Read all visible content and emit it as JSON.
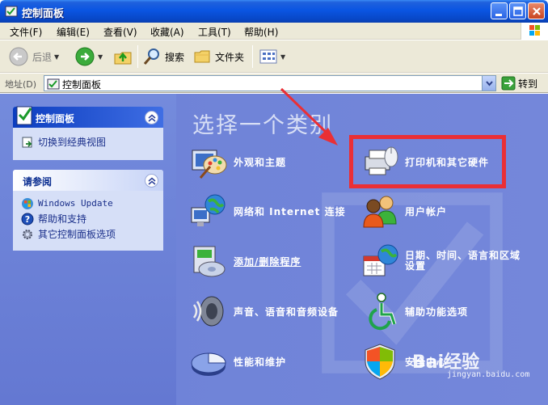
{
  "window": {
    "title": "控制面板"
  },
  "menu": [
    "文件(F)",
    "编辑(E)",
    "查看(V)",
    "收藏(A)",
    "工具(T)",
    "帮助(H)"
  ],
  "toolbar": {
    "back": "后退",
    "search": "搜索",
    "folders": "文件夹"
  },
  "address": {
    "label": "地址(D)",
    "value": "控制面板",
    "go": "转到"
  },
  "left_panels": {
    "control_panel": {
      "title": "控制面板",
      "items": [
        "切换到经典视图"
      ]
    },
    "see_also": {
      "title": "请参阅",
      "items": [
        "Windows Update",
        "帮助和支持",
        "其它控制面板选项"
      ]
    }
  },
  "main": {
    "heading": "选择一个类别",
    "categories": [
      "外观和主题",
      "打印机和其它硬件",
      "网络和 Internet 连接",
      "用户帐户",
      "添加/删除程序",
      "日期、时间、语言和区域设置",
      "声音、语音和音频设备",
      "辅助功能选项",
      "性能和维护",
      "安全中心"
    ]
  },
  "watermark": {
    "brand": "Bai经验",
    "url": "jingyan.baidu.com"
  },
  "colors": {
    "highlight": "#ea2f35",
    "titlebar": "#0a55e2",
    "pane": "#6f83d8"
  }
}
